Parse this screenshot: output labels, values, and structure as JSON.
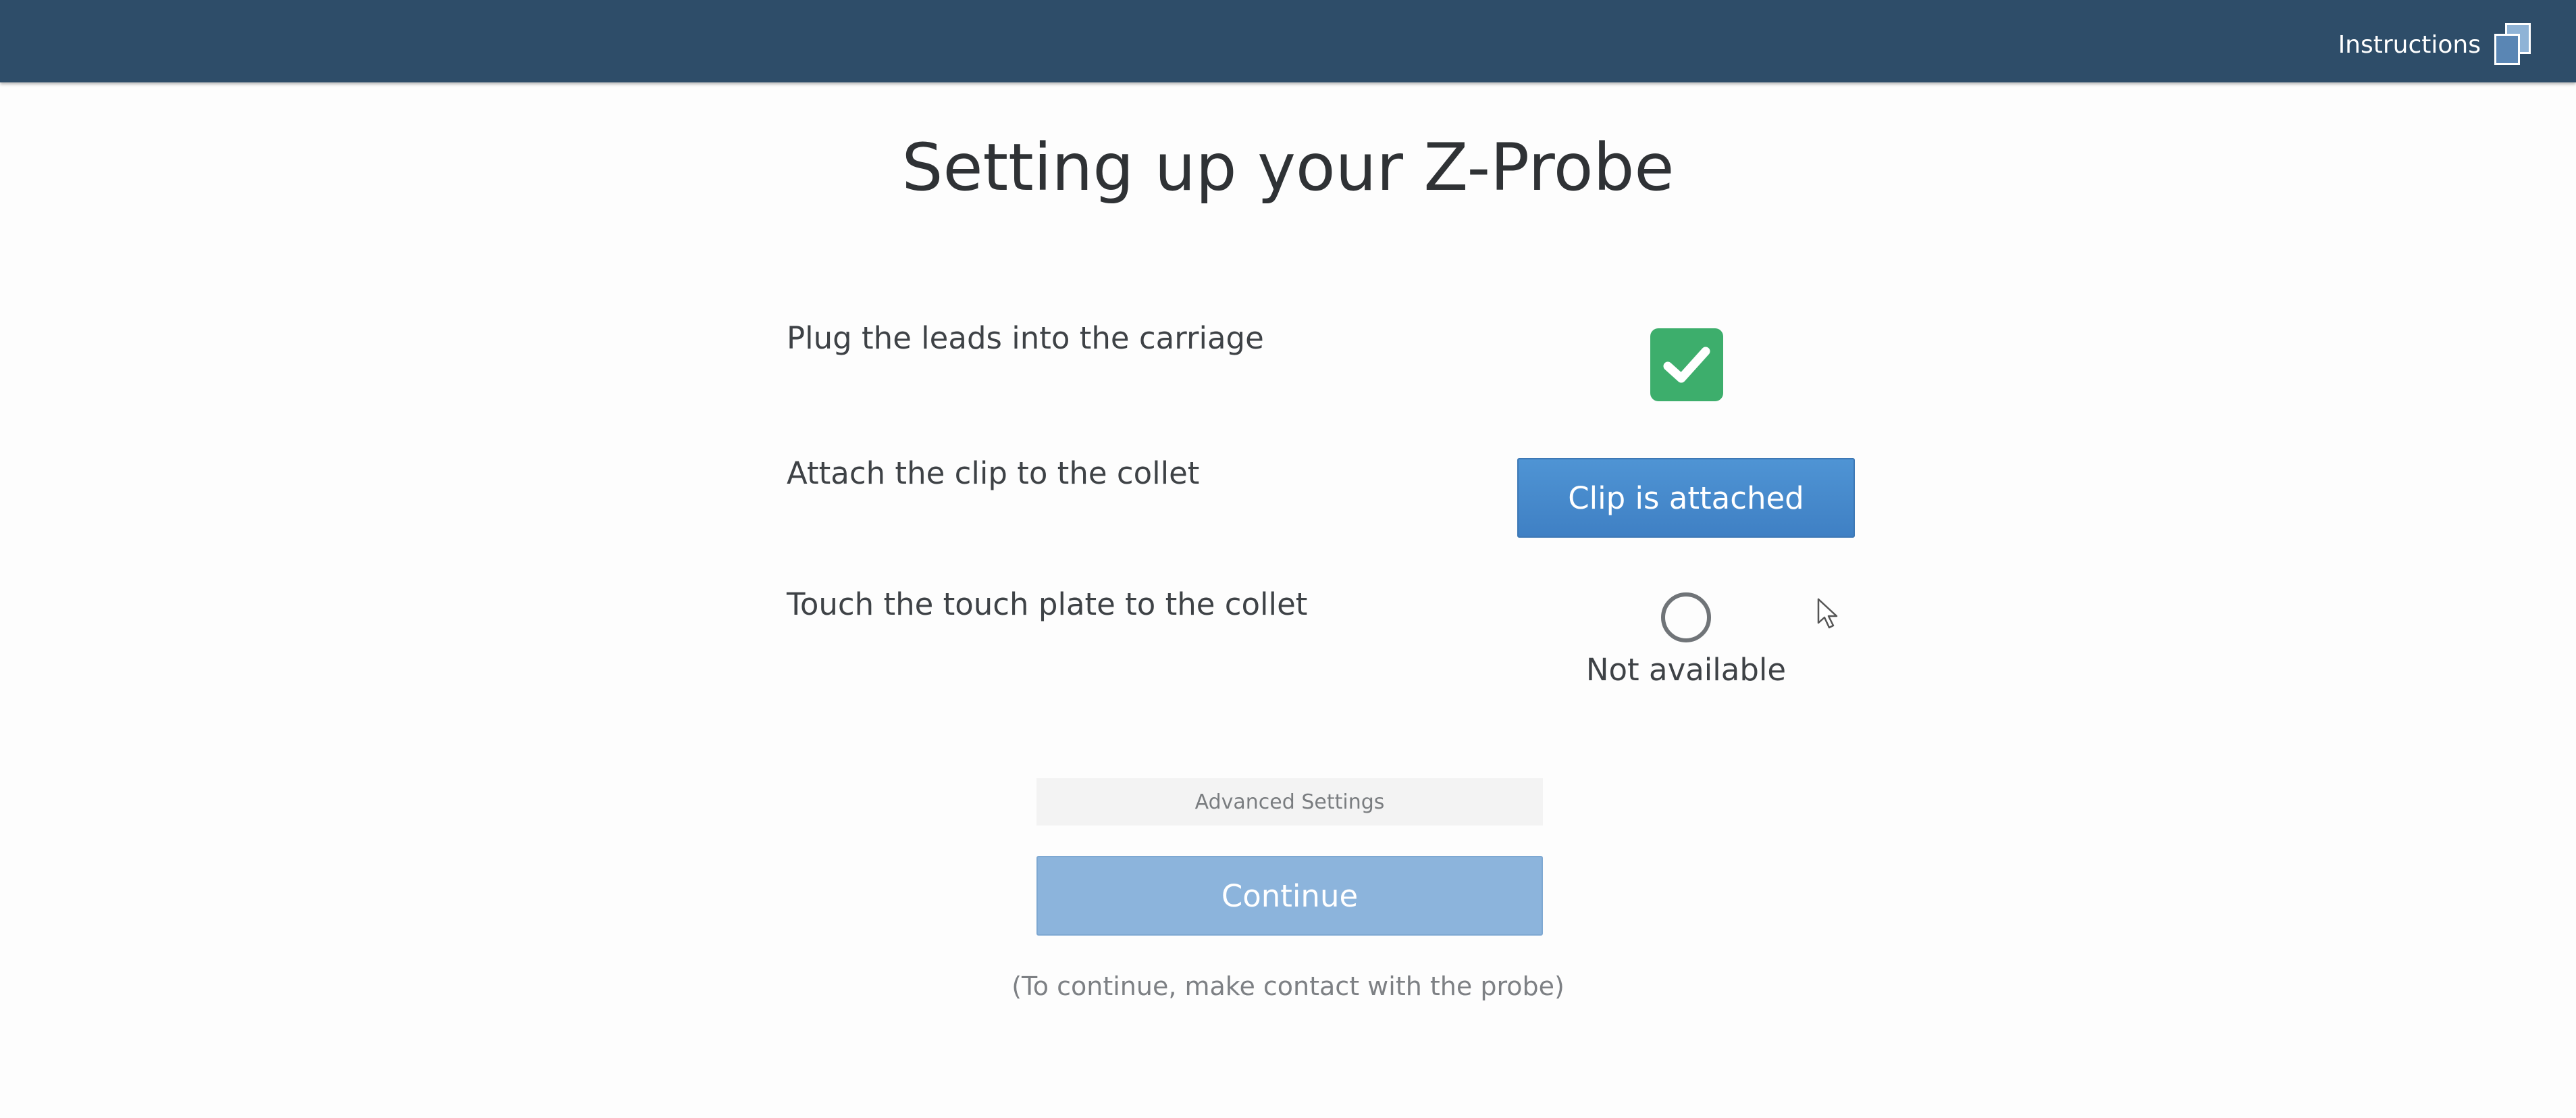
{
  "header": {
    "instructions_label": "Instructions",
    "instructions_icon": "copy-pages-icon",
    "background_color": "#2e4d69"
  },
  "page": {
    "title": "Setting up your Z-Probe"
  },
  "steps": [
    {
      "label": "Plug the leads into the carriage",
      "status": "complete",
      "icon": "check-icon"
    },
    {
      "label": "Attach the clip to the collet",
      "action_label": "Clip is attached"
    },
    {
      "label": "Touch the touch plate to the collet",
      "status_text": "Not available",
      "icon": "empty-circle-icon"
    }
  ],
  "advanced_settings_label": "Advanced Settings",
  "continue": {
    "label": "Continue",
    "enabled": false,
    "hint": "(To continue, make contact with the probe)"
  },
  "colors": {
    "success": "#3dae6c",
    "primary": "#4a8cce",
    "primary_disabled": "#8cb4dc"
  }
}
